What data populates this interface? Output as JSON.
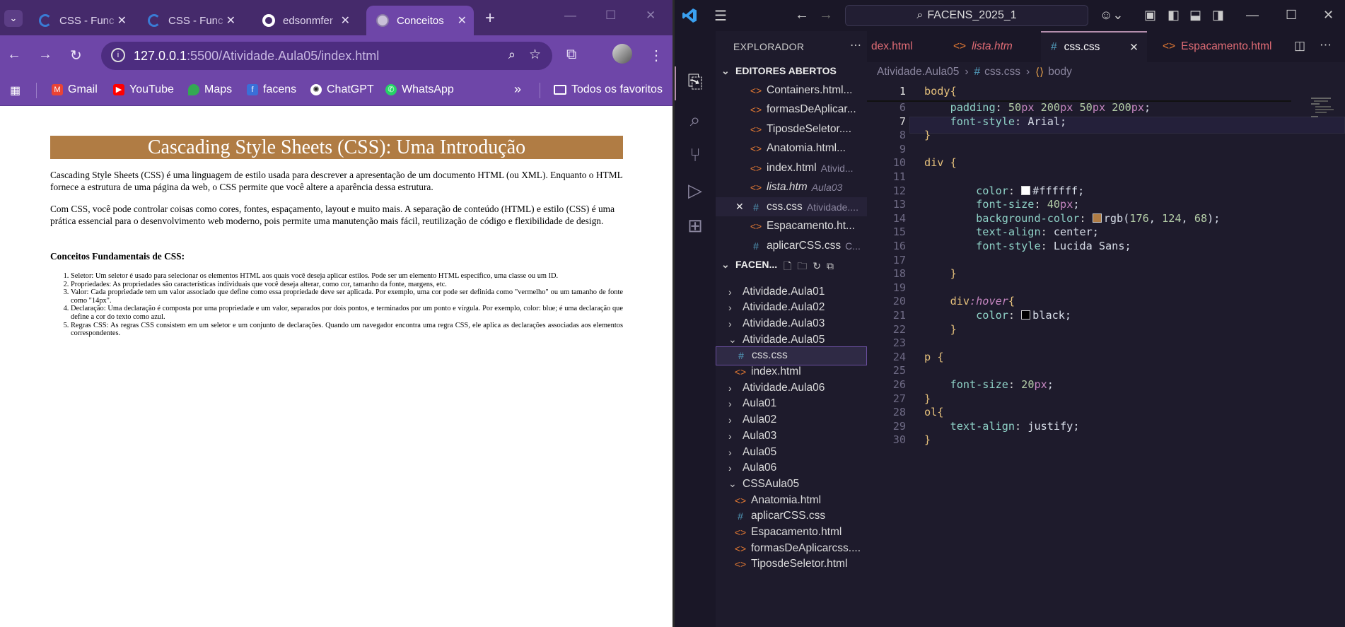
{
  "browser": {
    "tabs": [
      {
        "title": "CSS - Func",
        "active": false
      },
      {
        "title": "CSS - Func",
        "active": false
      },
      {
        "title": "edsonmfer",
        "active": false
      },
      {
        "title": "Conceitos",
        "active": true
      }
    ],
    "new_tab": "+",
    "url_host": "127.0.0.1",
    "url_path": ":5500/Atividade.Aula05/index.html",
    "bookmarks": [
      "Gmail",
      "YouTube",
      "Maps",
      "facens",
      "ChatGPT",
      "WhatsApp"
    ],
    "bookmarks_more": "»",
    "all_bookmarks": "Todos os favoritos"
  },
  "page": {
    "heading": "Cascading Style Sheets (CSS): Uma Introdução",
    "p1": "Cascading Style Sheets (CSS) é uma linguagem de estilo usada para descrever a apresentação de um documento HTML (ou XML). Enquanto o HTML fornece a estrutura de uma página da web, o CSS permite que você altere a aparência dessa estrutura.",
    "p2": "Com CSS, você pode controlar coisas como cores, fontes, espaçamento, layout e muito mais. A separação de conteúdo (HTML) e estilo (CSS) é uma prática essencial para o desenvolvimento web moderno, pois permite uma manutenção mais fácil, reutilização de código e flexibilidade de design.",
    "h3": "Conceitos Fundamentais de CSS:",
    "list": [
      "Seletor: Um seletor é usado para selecionar os elementos HTML aos quais você deseja aplicar estilos. Pode ser um elemento HTML específico, uma classe ou um ID.",
      "Propriedades: As propriedades são características individuais que você deseja alterar, como cor, tamanho da fonte, margens, etc.",
      "Valor: Cada propriedade tem um valor associado que define como essa propriedade deve ser aplicada. Por exemplo, uma cor pode ser definida como \"vermelho\" ou um tamanho de fonte como \"14px\".",
      "Declaração: Uma declaração é composta por uma propriedade e um valor, separados por dois pontos, e terminados por um ponto e vírgula. Por exemplo, color: blue; é uma declaração que define a cor do texto como azul.",
      "Regras CSS: As regras CSS consistem em um seletor e um conjunto de declarações. Quando um navegador encontra uma regra CSS, ele aplica as declarações associadas aos elementos correspondentes."
    ],
    "heading_bg": "#b07c44"
  },
  "vscode": {
    "search": "FACENS_2025_1",
    "explorer_title": "EXPLORADOR",
    "open_editors_title": "EDITORES ABERTOS",
    "open_editors": [
      {
        "name": "Containers.html...",
        "type": "html",
        "dim": "",
        "italic": false
      },
      {
        "name": "formasDeAplicar...",
        "type": "html",
        "dim": "",
        "italic": false
      },
      {
        "name": "TiposdeSeletor....",
        "type": "html",
        "dim": "",
        "italic": false
      },
      {
        "name": "Anatomia.html...",
        "type": "html",
        "dim": "",
        "italic": false
      },
      {
        "name": "index.html",
        "type": "html",
        "dim": "Ativid...",
        "italic": false
      },
      {
        "name": "lista.htm",
        "type": "html",
        "dim": "Aula03",
        "italic": true
      },
      {
        "name": "css.css",
        "type": "css",
        "dim": "Atividade....",
        "italic": false
      },
      {
        "name": "Espacamento.ht...",
        "type": "html",
        "dim": "",
        "italic": false
      },
      {
        "name": "aplicarCSS.css",
        "type": "css",
        "dim": "C...",
        "italic": false
      }
    ],
    "workspace_title": "FACEN...",
    "tree": [
      {
        "name": "Atividade.Aula01",
        "kind": "folder",
        "open": false,
        "indent": 0
      },
      {
        "name": "Atividade.Aula02",
        "kind": "folder",
        "open": false,
        "indent": 0
      },
      {
        "name": "Atividade.Aula03",
        "kind": "folder",
        "open": false,
        "indent": 0
      },
      {
        "name": "Atividade.Aula05",
        "kind": "folder",
        "open": true,
        "indent": 0
      },
      {
        "name": "css.css",
        "kind": "css",
        "open": false,
        "indent": 1
      },
      {
        "name": "index.html",
        "kind": "html",
        "open": false,
        "indent": 1
      },
      {
        "name": "Atividade.Aula06",
        "kind": "folder",
        "open": false,
        "indent": 0
      },
      {
        "name": "Aula01",
        "kind": "folder",
        "open": false,
        "indent": 0
      },
      {
        "name": "Aula02",
        "kind": "folder",
        "open": false,
        "indent": 0
      },
      {
        "name": "Aula03",
        "kind": "folder",
        "open": false,
        "indent": 0
      },
      {
        "name": "Aula05",
        "kind": "folder",
        "open": false,
        "indent": 0
      },
      {
        "name": "Aula06",
        "kind": "folder",
        "open": false,
        "indent": 0
      },
      {
        "name": "CSSAula05",
        "kind": "folder",
        "open": true,
        "indent": 0
      },
      {
        "name": "Anatomia.html",
        "kind": "html",
        "open": false,
        "indent": 1
      },
      {
        "name": "aplicarCSS.css",
        "kind": "css",
        "open": false,
        "indent": 1
      },
      {
        "name": "Espacamento.html",
        "kind": "html",
        "open": false,
        "indent": 1
      },
      {
        "name": "formasDeAplicarcss....",
        "kind": "html",
        "open": false,
        "indent": 1
      },
      {
        "name": "TiposdeSeletor.html",
        "kind": "html",
        "open": false,
        "indent": 1
      }
    ],
    "editor_tabs": [
      {
        "name": "dex.html",
        "type": "html",
        "active": false,
        "italic": false
      },
      {
        "name": "lista.htm",
        "type": "html",
        "active": false,
        "italic": true
      },
      {
        "name": "css.css",
        "type": "css",
        "active": true,
        "italic": false
      },
      {
        "name": "Espacamento.html",
        "type": "html",
        "active": false,
        "italic": false
      }
    ],
    "breadcrumb": [
      "Atividade.Aula05",
      "css.css",
      "body"
    ],
    "sticky": {
      "num": "1",
      "text": "body{"
    },
    "lines": [
      {
        "n": "6",
        "text": "    padding: 50px 200px 50px 200px;"
      },
      {
        "n": "7",
        "text": "    font-style: Arial;"
      },
      {
        "n": "8",
        "text": "}"
      },
      {
        "n": "9",
        "text": ""
      },
      {
        "n": "10",
        "text": "div {"
      },
      {
        "n": "11",
        "text": ""
      },
      {
        "n": "12",
        "text": "        color: #ffffff;"
      },
      {
        "n": "13",
        "text": "        font-size: 40px;"
      },
      {
        "n": "14",
        "text": "        background-color: rgb(176, 124, 68);"
      },
      {
        "n": "15",
        "text": "        text-align: center;"
      },
      {
        "n": "16",
        "text": "        font-style: Lucida Sans;"
      },
      {
        "n": "17",
        "text": ""
      },
      {
        "n": "18",
        "text": "    }"
      },
      {
        "n": "19",
        "text": ""
      },
      {
        "n": "20",
        "text": "    div:hover{"
      },
      {
        "n": "21",
        "text": "        color: black;"
      },
      {
        "n": "22",
        "text": "    }"
      },
      {
        "n": "23",
        "text": ""
      },
      {
        "n": "24",
        "text": "p {"
      },
      {
        "n": "25",
        "text": ""
      },
      {
        "n": "26",
        "text": "    font-size: 20px;"
      },
      {
        "n": "27",
        "text": "}"
      },
      {
        "n": "28",
        "text": "ol{"
      },
      {
        "n": "29",
        "text": "    text-align: justify;"
      },
      {
        "n": "30",
        "text": "}"
      }
    ],
    "current_line": "7",
    "swatches": {
      "white": "#ffffff",
      "brown": "#b07c44",
      "black": "#000000"
    }
  }
}
